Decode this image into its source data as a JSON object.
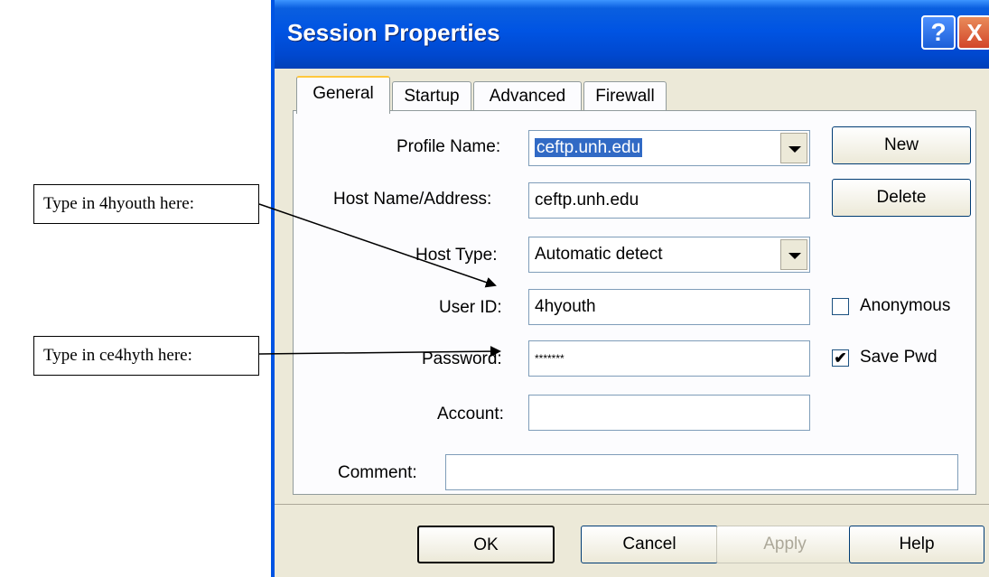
{
  "window": {
    "title": "Session Properties",
    "help_btn": "?",
    "close_btn": "X"
  },
  "tabs": [
    {
      "label": "General",
      "active": true
    },
    {
      "label": "Startup"
    },
    {
      "label": "Advanced"
    },
    {
      "label": "Firewall"
    }
  ],
  "form": {
    "profile_name": {
      "label": "Profile Name:",
      "value": "ceftp.unh.edu"
    },
    "host_name": {
      "label": "Host Name/Address:",
      "value": "ceftp.unh.edu"
    },
    "host_type": {
      "label": "Host Type:",
      "value": "Automatic detect"
    },
    "user_id": {
      "label": "User ID:",
      "value": "4hyouth"
    },
    "password": {
      "label": "Password:",
      "value": "*******"
    },
    "account": {
      "label": "Account:",
      "value": ""
    },
    "comment": {
      "label": "Comment:",
      "value": ""
    }
  },
  "buttons": {
    "new": "New",
    "delete": "Delete",
    "ok": "OK",
    "cancel": "Cancel",
    "apply": "Apply",
    "help": "Help"
  },
  "checkboxes": {
    "anonymous": {
      "label": "Anonymous",
      "checked": false
    },
    "save_pwd": {
      "label": "Save Pwd",
      "checked": true,
      "mark": "✔"
    }
  },
  "annotations": [
    {
      "text": "Type in 4hyouth here:"
    },
    {
      "text": "Type in ce4hyth here:"
    }
  ]
}
